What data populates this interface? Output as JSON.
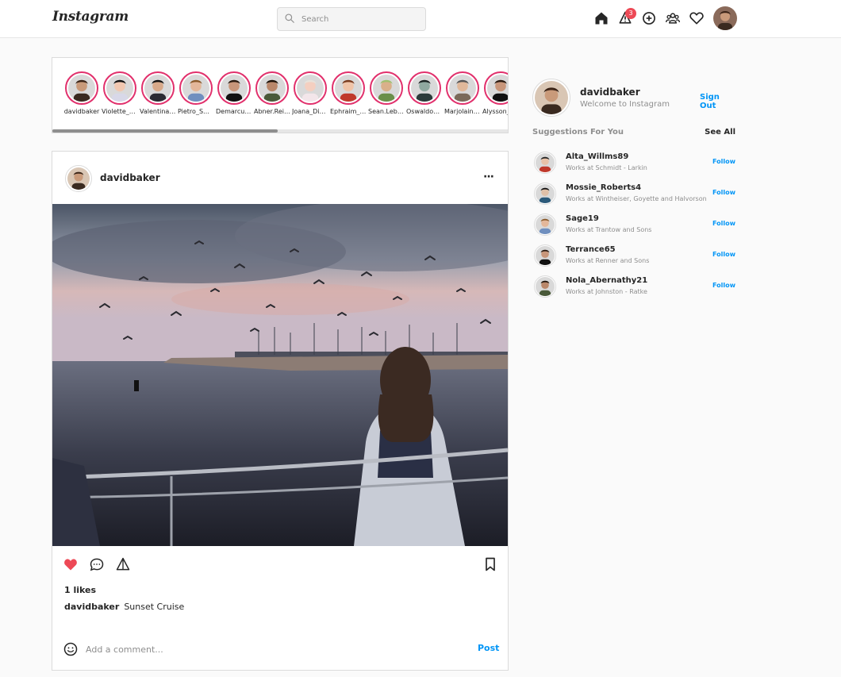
{
  "app": {
    "logo": "Instagram"
  },
  "search": {
    "placeholder": "Search"
  },
  "nav": {
    "notification_count": "3"
  },
  "stories": [
    {
      "name": "davidbaker",
      "shirt": "#3a2a20",
      "skin": "#c99a7a",
      "hair": "#3b2417"
    },
    {
      "name": "Violette_Bosco",
      "shirt": "#d8d8e8",
      "skin": "#f1c7b0",
      "hair": "#111111"
    },
    {
      "name": "Valentina_Moore",
      "shirt": "#2b2b33",
      "skin": "#d7a98a",
      "hair": "#101010"
    },
    {
      "name": "Pietro_Smith",
      "shirt": "#6f8fbf",
      "skin": "#e3b79a",
      "hair": "#8a5a2b"
    },
    {
      "name": "Demarcus_Howe",
      "shirt": "#111111",
      "skin": "#c8967a",
      "hair": "#2a1a10"
    },
    {
      "name": "Abner.Reilly",
      "shirt": "#4a5a3a",
      "skin": "#b9876a",
      "hair": "#1d1208"
    },
    {
      "name": "Joana_Dietrich",
      "shirt": "#f3e6ea",
      "skin": "#f4cfc0",
      "hair": "#e8e2da"
    },
    {
      "name": "Ephraim_Kub",
      "shirt": "#c0392b",
      "skin": "#f0c4a8",
      "hair": "#7a3b1e"
    },
    {
      "name": "Sean.Lebsack",
      "shirt": "#6a8f4a",
      "skin": "#d9b08a",
      "hair": "#a0c070"
    },
    {
      "name": "Oswaldo_Kris",
      "shirt": "#2b3a3a",
      "skin": "#8fa8a0",
      "hair": "#1a2222"
    },
    {
      "name": "Marjolaine_Ward",
      "shirt": "#7a6a5a",
      "skin": "#e0b89a",
      "hair": "#555555"
    },
    {
      "name": "Alysson_Ryan",
      "shirt": "#111111",
      "skin": "#c8967a",
      "hair": "#2a1a10"
    }
  ],
  "post": {
    "username": "davidbaker",
    "likes_text": "1 likes",
    "caption_user": "davidbaker",
    "caption": "Sunset Cruise",
    "comment_placeholder": "Add a comment...",
    "post_label": "Post",
    "more_label": "···",
    "liked": true
  },
  "me": {
    "username": "davidbaker",
    "subtitle": "Welcome to Instagram",
    "signout_label": "Sign Out"
  },
  "suggestions": {
    "title": "Suggestions For You",
    "see_all": "See All",
    "follow_label": "Follow",
    "items": [
      {
        "name": "Alta_Willms89",
        "sub": "Works at Schmidt - Larkin",
        "shirt": "#c0392b",
        "skin": "#e8c2a8",
        "hair": "#222222"
      },
      {
        "name": "Mossie_Roberts4",
        "sub": "Works at Wintheiser, Goyette and Halvorson",
        "shirt": "#2c5a7a",
        "skin": "#e0c0a8",
        "hair": "#0f0f0f"
      },
      {
        "name": "Sage19",
        "sub": "Works at Trantow and Sons",
        "shirt": "#6f8fbf",
        "skin": "#e3b79a",
        "hair": "#8a5a2b"
      },
      {
        "name": "Terrance65",
        "sub": "Works at Renner and Sons",
        "shirt": "#111111",
        "skin": "#c8967a",
        "hair": "#2a1a10"
      },
      {
        "name": "Nola_Abernathy21",
        "sub": "Works at Johnston - Ratke",
        "shirt": "#4a5a3a",
        "skin": "#b9876a",
        "hair": "#1d1208"
      }
    ]
  },
  "colors": {
    "accent": "#0095f6",
    "like": "#ed4956",
    "story_ring": "#e1306c"
  },
  "icons": [
    "search-icon",
    "home-icon",
    "bell-icon",
    "add-icon",
    "people-icon",
    "heart-outline-icon",
    "heart-filled-icon",
    "comment-icon",
    "share-icon",
    "bookmark-icon",
    "smile-icon",
    "more-icon"
  ]
}
